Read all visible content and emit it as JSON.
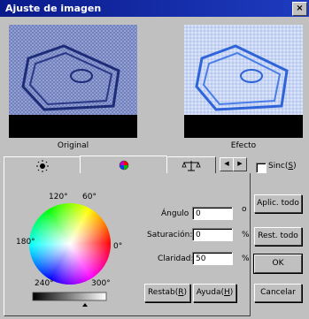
{
  "window": {
    "title": "Ajuste de imagen",
    "close_label": "×"
  },
  "previews": {
    "original_label": "Original",
    "effect_label": "Efecto"
  },
  "tabs": [
    {
      "icon": "brightness-icon"
    },
    {
      "icon": "color-wheel-icon"
    },
    {
      "icon": "balance-icon"
    }
  ],
  "tab_scroll": {
    "left": "◀",
    "right": "▶"
  },
  "sync": {
    "label": "Sinc(S)",
    "label_pre": "Sinc(",
    "label_key": "S",
    "label_post": ")",
    "checked": false
  },
  "wheel_labels": {
    "deg120": "120°",
    "deg60": "60°",
    "deg180": "180°",
    "deg0": "0°",
    "deg240": "240°",
    "deg300": "300°"
  },
  "fields": {
    "angle": {
      "label": "Ángulo",
      "value": "0",
      "unit": "o"
    },
    "saturation": {
      "label": "Saturación:",
      "value": "0",
      "unit": "%"
    },
    "brightness": {
      "label": "Claridad:",
      "value": "50",
      "unit": "%"
    }
  },
  "buttons": {
    "reset_pre": "Restab(",
    "reset_key": "R",
    "reset_post": ")",
    "help_pre": "Ayuda(",
    "help_key": "H",
    "help_post": ")",
    "apply_all": "Aplic. todo",
    "reset_all": "Rest. todo",
    "ok": "OK",
    "cancel": "Cancelar"
  },
  "colors": {
    "titlebar": "#0a1a8a",
    "preview_bg": "#000000",
    "original_tint": "#7a88c0",
    "effect_tint": "#4a78e0"
  }
}
